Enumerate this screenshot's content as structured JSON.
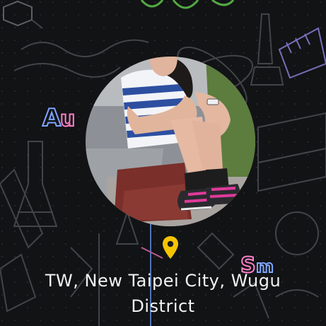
{
  "profile": {
    "location_text": "TW, New Taipei City, Wugu District"
  },
  "icons": {
    "pin": "location-pin-icon",
    "avatar": "profile-avatar"
  },
  "colors": {
    "background": "#111214",
    "pin": "#f4c400",
    "text": "#f2f2f2",
    "doodle_green": "#7adf5a",
    "doodle_pink": "#ff7fc8",
    "doodle_blue": "#7aa8ff"
  }
}
